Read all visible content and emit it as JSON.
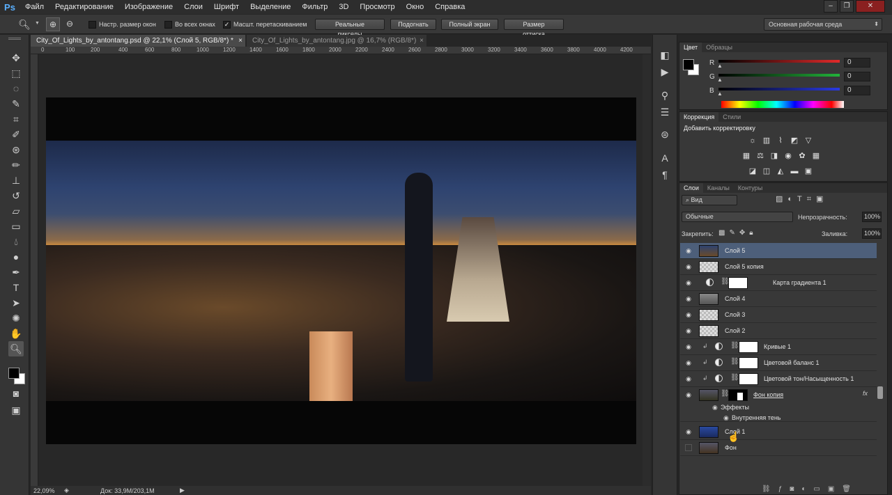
{
  "app": {
    "logo": "Ps"
  },
  "menu": [
    "Файл",
    "Редактирование",
    "Изображение",
    "Слои",
    "Шрифт",
    "Выделение",
    "Фильтр",
    "3D",
    "Просмотр",
    "Окно",
    "Справка"
  ],
  "options": {
    "resize_windows": "Настр. размер окон",
    "all_windows": "Во всех окнах",
    "scrubby_zoom": "Масшт. перетаскиванием",
    "actual_pixels": "Реальные пикселы",
    "fit_screen": "Подогнать",
    "fill_screen": "Полный экран",
    "print_size": "Размер оттиска",
    "workspace": "Основная рабочая среда"
  },
  "tabs": [
    {
      "title": "City_Of_Lights_by_antontang.psd @ 22,1% (Слой 5, RGB/8*) *",
      "active": true
    },
    {
      "title": "City_Of_Lights_by_antontang.jpg @ 16,7% (RGB/8*)",
      "active": false
    }
  ],
  "ruler": [
    "0",
    "100",
    "200",
    "400",
    "600",
    "800",
    "1000",
    "1200",
    "1400",
    "1600",
    "1800",
    "2000",
    "2200",
    "2400",
    "2600",
    "2800",
    "3000",
    "3200",
    "3400",
    "3600",
    "3800",
    "4000",
    "4200"
  ],
  "status": {
    "zoom": "22,09%",
    "doc": "Док: 33,9M/203,1M"
  },
  "color_panel": {
    "tabs": [
      "Цвет",
      "Образцы"
    ],
    "channels": [
      {
        "label": "R",
        "value": "0",
        "color": "#e22a2a"
      },
      {
        "label": "G",
        "value": "0",
        "color": "#22b33a"
      },
      {
        "label": "B",
        "value": "0",
        "color": "#2a3ae2"
      }
    ]
  },
  "adjust_panel": {
    "tabs": [
      "Коррекция",
      "Стили"
    ],
    "title": "Добавить корректировку"
  },
  "layers_panel": {
    "tabs": [
      "Слои",
      "Каналы",
      "Контуры"
    ],
    "filter": "Вид",
    "blend_mode": "Обычные",
    "opacity_label": "Непрозрачность:",
    "opacity": "100%",
    "lock_label": "Закрепить:",
    "fill_label": "Заливка:",
    "fill": "100%",
    "layers": [
      {
        "name": "Слой 5",
        "selected": true
      },
      {
        "name": "Слой 5 копия"
      },
      {
        "name": "Карта градиента 1"
      },
      {
        "name": "Слой 4"
      },
      {
        "name": "Слой 3"
      },
      {
        "name": "Слой 2"
      },
      {
        "name": "Кривые 1"
      },
      {
        "name": "Цветовой баланс 1"
      },
      {
        "name": "Цветовой тон/Насыщенность 1"
      },
      {
        "name": "Фон копия"
      },
      {
        "name": "Слой 1"
      },
      {
        "name": "Фон"
      }
    ],
    "effects_label": "Эффекты",
    "inner_shadow": "Внутренняя тень",
    "fx": "fx"
  }
}
